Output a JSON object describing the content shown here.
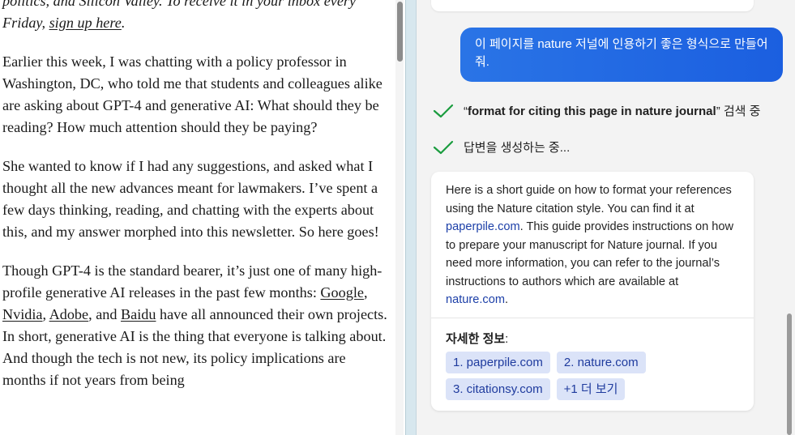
{
  "article": {
    "intro_line1": "politics, and Silicon Valley. To receive it in your inbox every",
    "intro_line2_prefix": "Friday, ",
    "intro_link": "sign up here",
    "intro_line2_suffix": ".",
    "para1": "Earlier this week, I was chatting with a policy professor in Washington, DC, who told me that students and colleagues alike are asking about GPT-4 and generative AI: What should they be reading? How much attention should they be paying?",
    "para2": "She wanted to know if I had any suggestions, and asked what I thought all the new advances meant for lawmakers. I’ve spent a few days thinking, reading, and chatting with the experts about this, and my answer morphed into this newsletter. So here goes!",
    "para3_prefix": "Though GPT-4 is the standard bearer, it’s just one of many high-profile generative AI releases in the past few months: ",
    "links": [
      "Google",
      "Nvidia",
      "Adobe",
      "Baidu"
    ],
    "sep1": ", ",
    "sep2": ", ",
    "sep3": ", and ",
    "para3_suffix": " have all announced their own projects. In short, generative AI is the thing that everyone is talking about. And though the tech is not new, its policy implications are months if not years from being"
  },
  "chat": {
    "user_message": "이 페이지를 nature 저널에 인용하기 좋은 형식으로 만들어줘.",
    "status_search_quote_open": "“",
    "status_search_query": "format for citing this page in nature journal",
    "status_search_quote_close": "”",
    "status_search_suffix": " 검색 중",
    "status_generating": "답변을 생성하는 중...",
    "answer_part1": "Here is a short guide on how to format your references using the Nature citation style. You can find it at ",
    "answer_link1": "paperpile.com",
    "answer_part2": ". This guide provides instructions on how to prepare your manuscript for Nature journal. If you need more information, you can refer to the journal’s instructions to authors which are available at ",
    "answer_link2": "nature.com",
    "answer_part3": ".",
    "more_info_label": "자세한 정보",
    "more_info_colon": ":",
    "sources": [
      "1. paperpile.com",
      "2. nature.com",
      "3. citationsy.com",
      "+1 더 보기"
    ]
  },
  "colors": {
    "user_bubble": "#1b5fe0",
    "check": "#1a9c3e",
    "chip_bg": "#dbe3f8",
    "link": "#1c3fa8"
  },
  "icons": {
    "status_icon": "checkmark-icon"
  }
}
